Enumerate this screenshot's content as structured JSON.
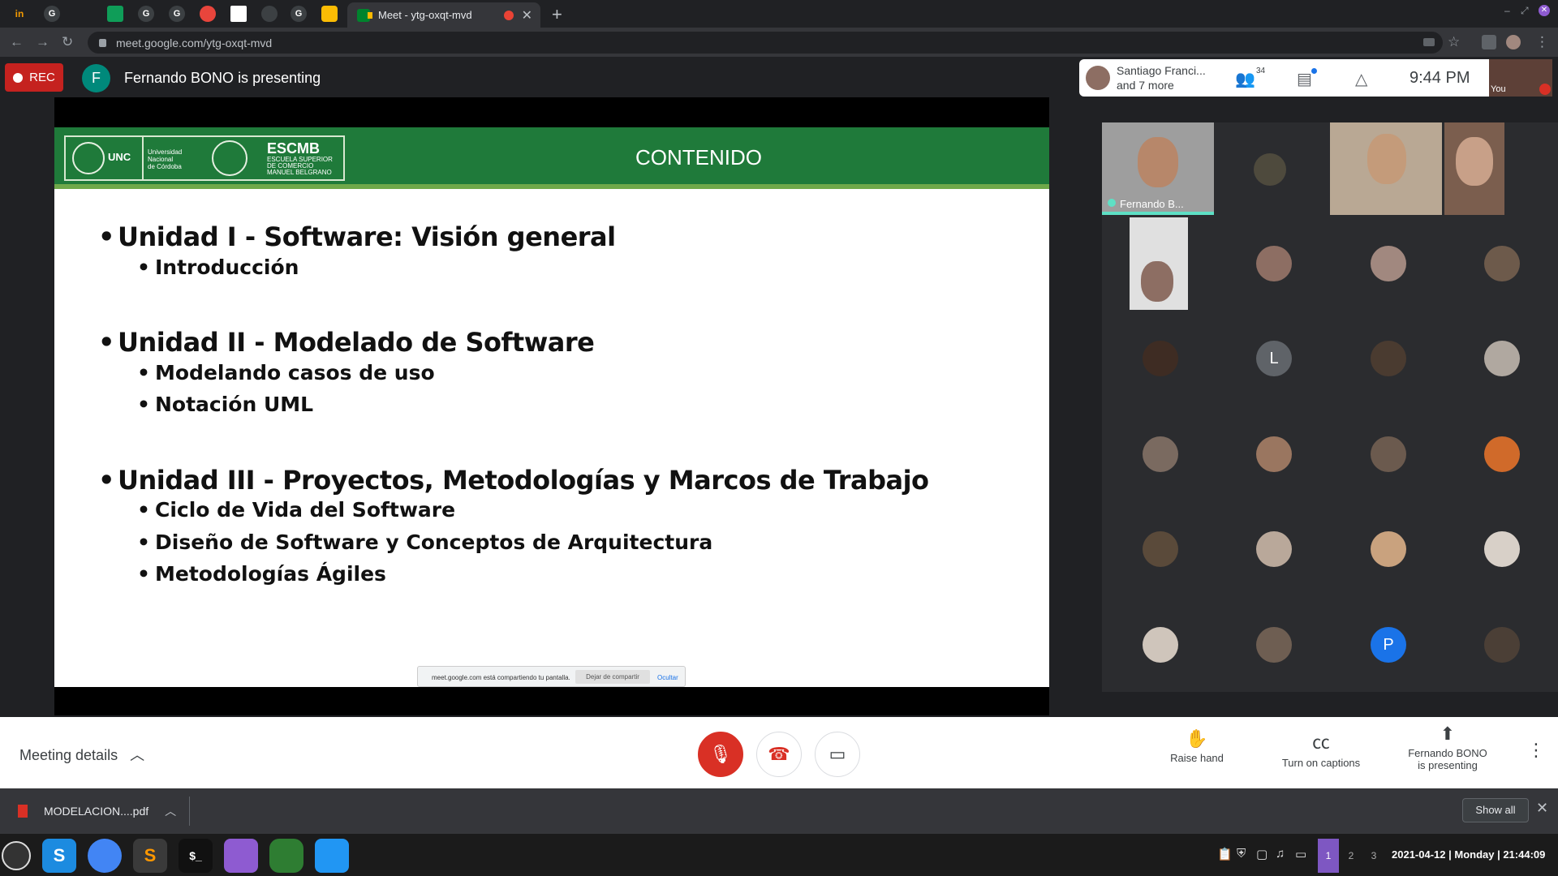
{
  "browser": {
    "active_tab_title": "Meet - ytg-oxqt-mvd",
    "url": "meet.google.com/ytg-oxqt-mvd"
  },
  "meet": {
    "rec_label": "REC",
    "presenter_initial": "F",
    "presenting_text": "Fernando BONO is presenting",
    "top_card": {
      "name": "Santiago Franci...",
      "more": "and 7 more"
    },
    "participants_count": "34",
    "time": "9:44 PM",
    "self_label": "You"
  },
  "slide": {
    "title": "CONTENIDO",
    "logo_unc": "UNC",
    "logo_university": [
      "Universidad",
      "Nacional",
      "de Córdoba"
    ],
    "logo_escmb": "ESCMB",
    "logo_escmb_sub": [
      "ESCUELA SUPERIOR",
      "DE COMERCIO",
      "MANUEL BELGRANO"
    ],
    "units": [
      {
        "title": "Unidad I - Software: Visión general",
        "items": [
          "Introducción"
        ]
      },
      {
        "title": "Unidad II - Modelado de Software",
        "items": [
          "Modelando casos de uso",
          "Notación UML"
        ]
      },
      {
        "title": "Unidad III - Proyectos, Metodologías y Marcos de Trabajo",
        "items": [
          "Ciclo de Vida del Software",
          "Diseño de Software y Conceptos de Arquitectura",
          "Metodologías Ágiles"
        ]
      }
    ],
    "share_bar": {
      "message": "meet.google.com está compartiendo tu pantalla.",
      "stop_label": "Dejar de compartir",
      "hide_label": "Ocultar"
    }
  },
  "grid": {
    "speaker_name": "Fernando B...",
    "letters": [
      "L",
      "P"
    ]
  },
  "controls": {
    "meeting_details": "Meeting details",
    "raise_hand": "Raise hand",
    "captions": "Turn on captions",
    "presenting_line1": "Fernando BONO",
    "presenting_line2": "is presenting"
  },
  "downloads": {
    "file": "MODELACION....pdf",
    "show_all": "Show all"
  },
  "taskbar": {
    "workspaces": [
      "1",
      "2",
      "3"
    ],
    "datetime": "2021-04-12 | Monday | 21:44:09"
  },
  "colors": {
    "rec_red": "#c5221f",
    "slide_green": "#1f7a3a",
    "mic_off_red": "#d93025",
    "presenter_teal": "#00897b",
    "avatar_blue": "#1a73e8",
    "workspace_active": "#7e57c2"
  }
}
